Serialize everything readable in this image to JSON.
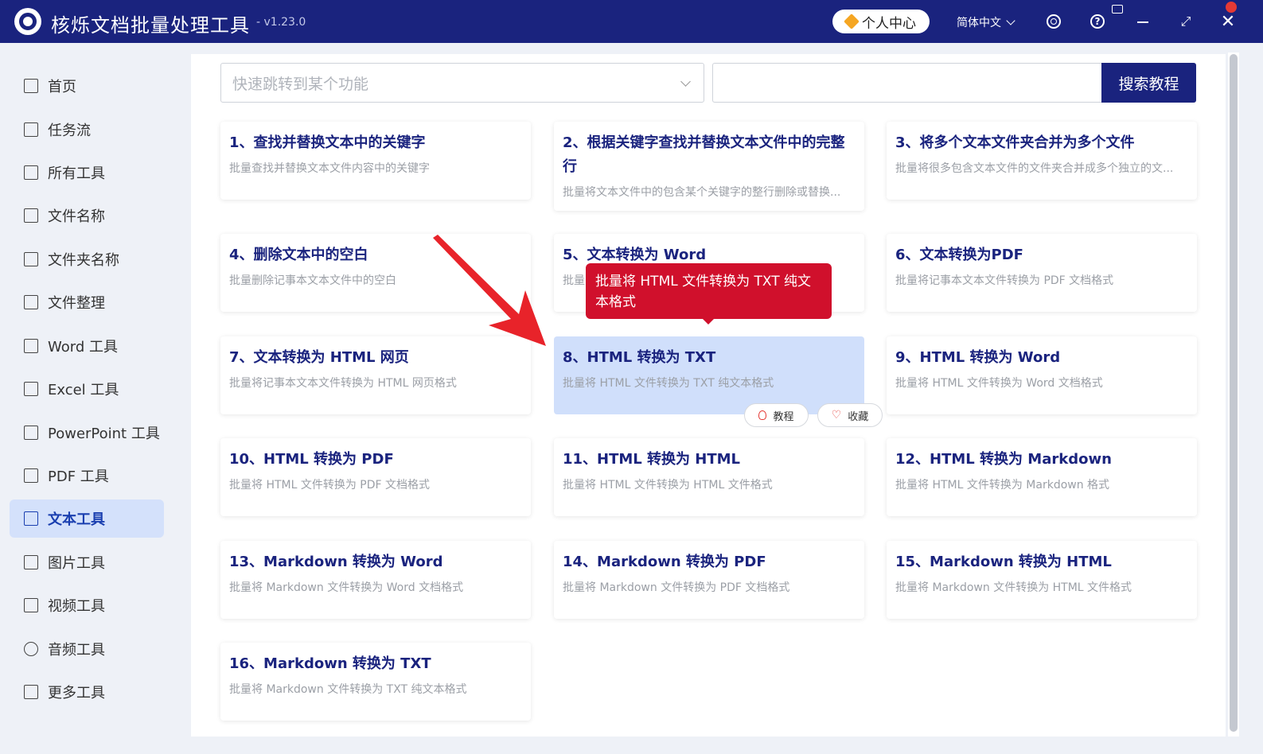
{
  "titlebar": {
    "title": "核烁文档批量处理工具",
    "version": "- v1.23.0",
    "user_center": "个人中心",
    "language": "简体中文"
  },
  "sidebar": {
    "items": [
      {
        "label": "首页",
        "icon": "home-icon"
      },
      {
        "label": "任务流",
        "icon": "workflow-icon"
      },
      {
        "label": "所有工具",
        "icon": "monitor-icon"
      },
      {
        "label": "文件名称",
        "icon": "file-icon"
      },
      {
        "label": "文件夹名称",
        "icon": "folder-icon"
      },
      {
        "label": "文件整理",
        "icon": "organize-icon"
      },
      {
        "label": "Word 工具",
        "icon": "word-icon"
      },
      {
        "label": "Excel 工具",
        "icon": "excel-icon"
      },
      {
        "label": "PowerPoint 工具",
        "icon": "powerpoint-icon"
      },
      {
        "label": "PDF 工具",
        "icon": "pdf-icon"
      },
      {
        "label": "文本工具",
        "icon": "text-icon",
        "active": true
      },
      {
        "label": "图片工具",
        "icon": "image-icon"
      },
      {
        "label": "视频工具",
        "icon": "video-icon"
      },
      {
        "label": "音频工具",
        "icon": "microphone-icon"
      },
      {
        "label": "更多工具",
        "icon": "grid-icon"
      }
    ]
  },
  "search": {
    "jump_placeholder": "快速跳转到某个功能",
    "button": "搜索教程"
  },
  "cards": [
    {
      "title": "1、查找并替换文本中的关键字",
      "desc": "批量查找并替换文本文件内容中的关键字"
    },
    {
      "title": "2、根据关键字查找并替换文本文件中的完整行",
      "desc": "批量将文本文件中的包含某个关键字的整行删除或替换..."
    },
    {
      "title": "3、将多个文本文件夹合并为多个文件",
      "desc": "批量将很多包含文本文件的文件夹合并成多个独立的文..."
    },
    {
      "title": "4、删除文本中的空白",
      "desc": "批量删除记事本文本文件中的空白"
    },
    {
      "title": "5、文本转换为 Word",
      "desc": "批量"
    },
    {
      "title": "6、文本转换为PDF",
      "desc": "批量将记事本文本文件转换为 PDF 文档格式"
    },
    {
      "title": "7、文本转换为 HTML 网页",
      "desc": "批量将记事本文本文件转换为 HTML 网页格式"
    },
    {
      "title": "8、HTML 转换为 TXT",
      "desc": "批量将 HTML 文件转换为 TXT 纯文本格式"
    },
    {
      "title": "9、HTML 转换为 Word",
      "desc": "批量将 HTML 文件转换为 Word 文档格式"
    },
    {
      "title": "10、HTML 转换为 PDF",
      "desc": "批量将 HTML 文件转换为 PDF 文档格式"
    },
    {
      "title": "11、HTML 转换为 HTML",
      "desc": "批量将 HTML 文件转换为 HTML 文件格式"
    },
    {
      "title": "12、HTML 转换为 Markdown",
      "desc": "批量将 HTML 文件转换为 Markdown 格式"
    },
    {
      "title": "13、Markdown 转换为 Word",
      "desc": "批量将 Markdown 文件转换为 Word 文档格式"
    },
    {
      "title": "14、Markdown 转换为 PDF",
      "desc": "批量将 Markdown 文件转换为 PDF 文档格式"
    },
    {
      "title": "15、Markdown 转换为 HTML",
      "desc": "批量将 Markdown 文件转换为 HTML 文件格式"
    },
    {
      "title": "16、Markdown 转换为 TXT",
      "desc": "批量将 Markdown 文件转换为 TXT 纯文本格式"
    }
  ],
  "hover_actions": {
    "tutorial": "教程",
    "favorite": "收藏"
  },
  "tooltip": "批量将 HTML 文件转换为 TXT 纯文本格式",
  "colors": {
    "brand": "#1a237e",
    "highlight_card": "#d0dffb",
    "tooltip": "#d0102c",
    "annotation_arrow": "#e8232a"
  }
}
